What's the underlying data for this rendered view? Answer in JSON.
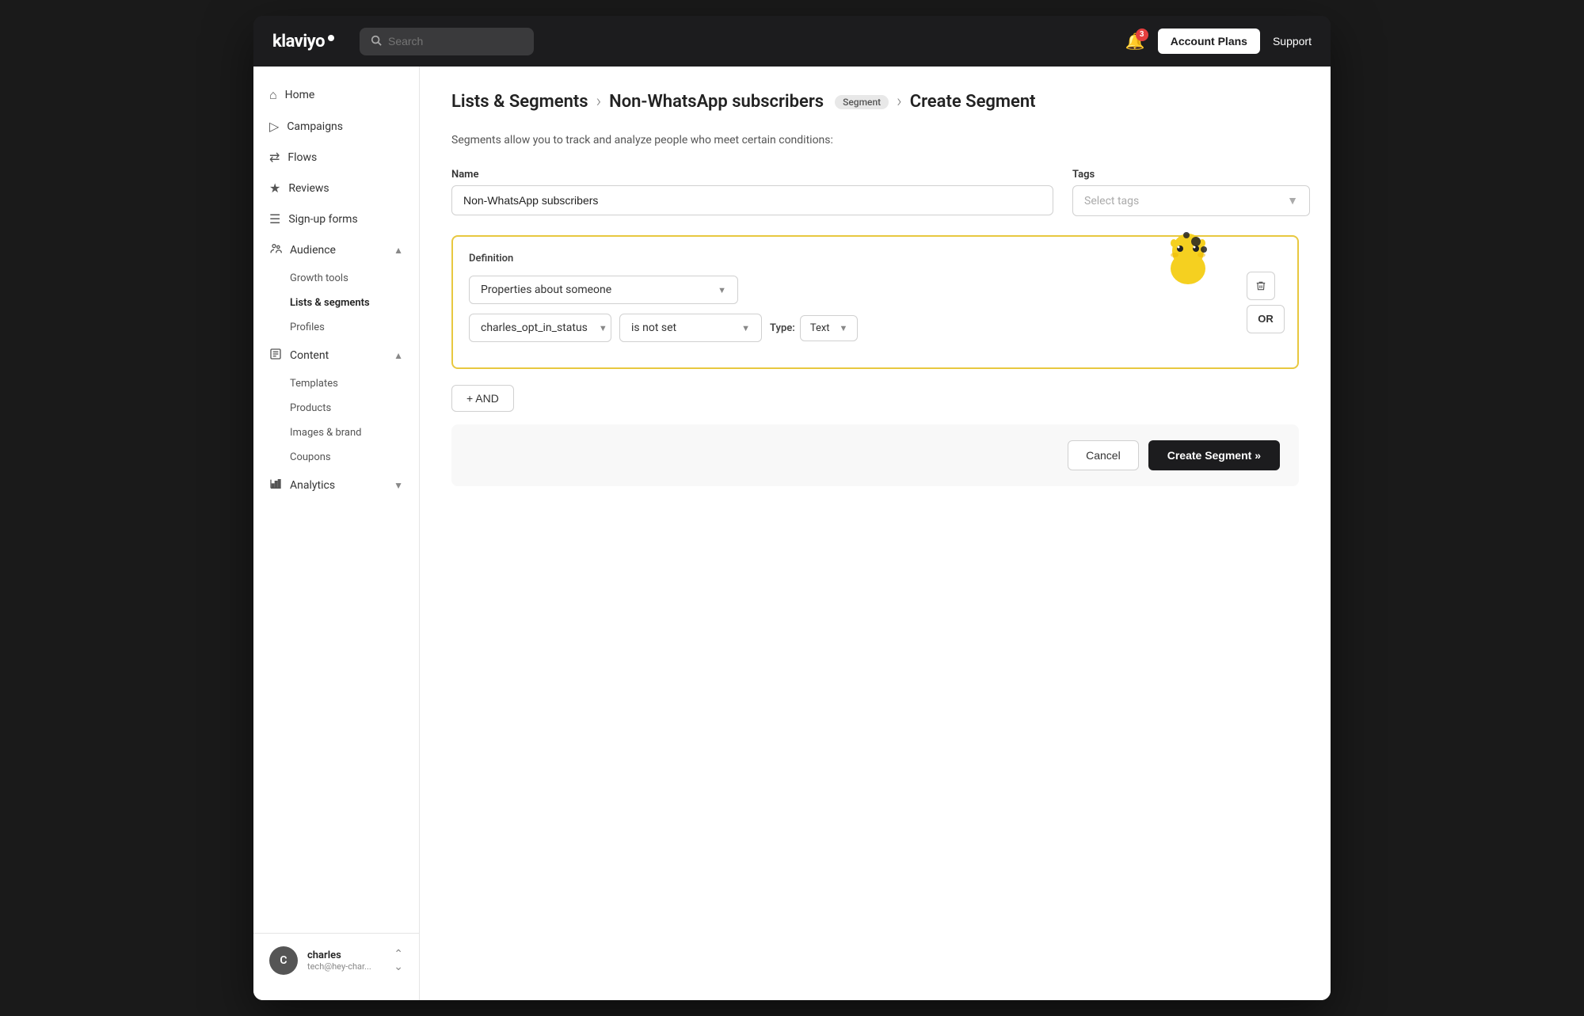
{
  "header": {
    "logo": "klaviyo",
    "search_placeholder": "Search",
    "notification_count": "3",
    "account_plans_label": "Account Plans",
    "support_label": "Support"
  },
  "breadcrumb": {
    "lists_segments": "Lists & Segments",
    "segment_name": "Non-WhatsApp subscribers",
    "badge": "Segment",
    "current": "Create Segment"
  },
  "description": "Segments allow you to track and analyze people who meet certain conditions:",
  "form": {
    "name_label": "Name",
    "name_value": "Non-WhatsApp subscribers",
    "tags_label": "Tags",
    "tags_placeholder": "Select tags"
  },
  "definition": {
    "title": "Definition",
    "condition_type": "Properties about someone",
    "field": "charles_opt_in_status",
    "operator": "is not set",
    "type_label": "Type:",
    "type_value": "Text",
    "delete_icon": "🗑",
    "or_label": "OR"
  },
  "and_button": "+ AND",
  "footer": {
    "cancel_label": "Cancel",
    "create_label": "Create Segment »"
  },
  "sidebar": {
    "items": [
      {
        "id": "home",
        "icon": "⌂",
        "label": "Home"
      },
      {
        "id": "campaigns",
        "icon": "▷",
        "label": "Campaigns"
      },
      {
        "id": "flows",
        "icon": "⇄",
        "label": "Flows"
      },
      {
        "id": "reviews",
        "icon": "★",
        "label": "Reviews"
      },
      {
        "id": "signup-forms",
        "icon": "☰",
        "label": "Sign-up forms"
      },
      {
        "id": "audience",
        "icon": "👥",
        "label": "Audience",
        "expanded": true
      },
      {
        "id": "content",
        "icon": "📄",
        "label": "Content",
        "expanded": true
      },
      {
        "id": "analytics",
        "icon": "📊",
        "label": "Analytics"
      }
    ],
    "audience_sub": [
      {
        "id": "growth-tools",
        "label": "Growth tools"
      },
      {
        "id": "lists-segments",
        "label": "Lists & segments",
        "active": true
      },
      {
        "id": "profiles",
        "label": "Profiles"
      }
    ],
    "content_sub": [
      {
        "id": "templates",
        "label": "Templates"
      },
      {
        "id": "products",
        "label": "Products"
      },
      {
        "id": "images-brand",
        "label": "Images & brand"
      },
      {
        "id": "coupons",
        "label": "Coupons"
      }
    ],
    "user": {
      "name": "charles",
      "email": "tech@hey-char...",
      "avatar_letter": "C"
    }
  }
}
